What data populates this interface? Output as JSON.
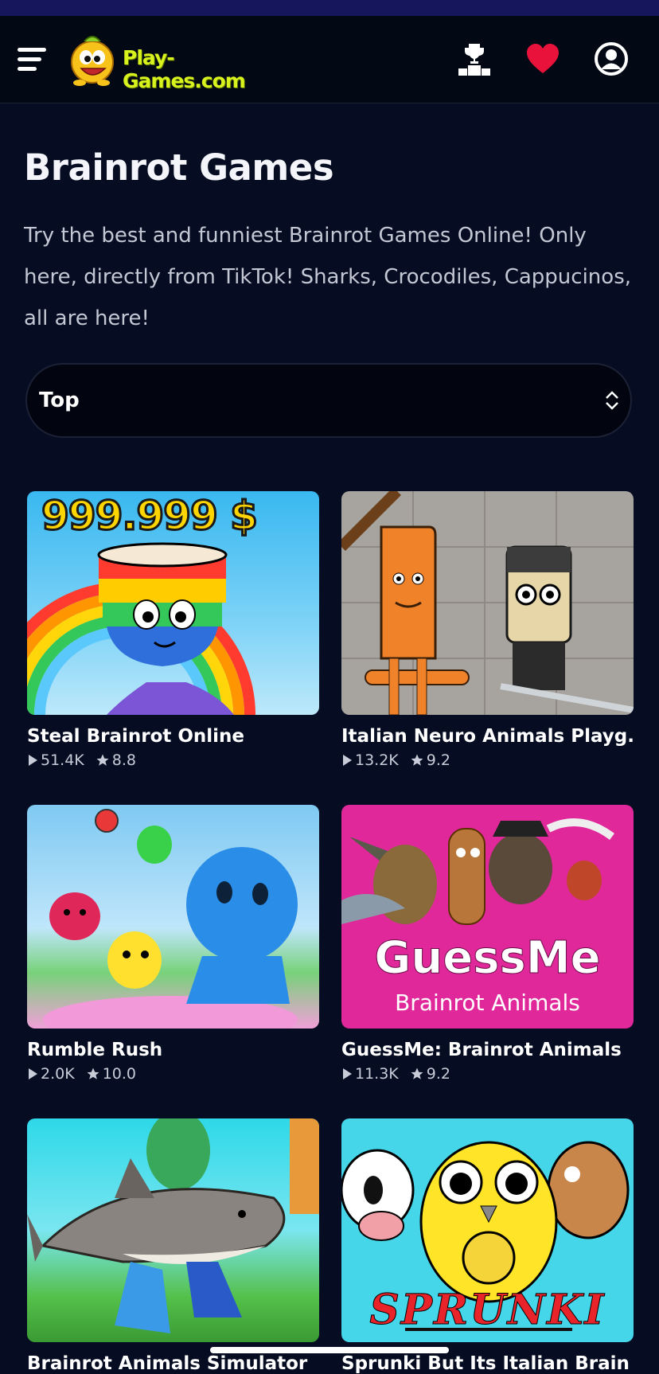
{
  "header": {
    "logo_text": "Play-Games.com",
    "icons": [
      "menu-icon",
      "trophy-icon",
      "heart-icon",
      "user-icon"
    ],
    "heart_color": "#e8123a"
  },
  "page": {
    "title": "Brainrot Games",
    "description": "Try the best and funniest Brainrot Games Online! Only here, directly from TikTok! Sharks, Crocodiles, Cappucinos, all are here!"
  },
  "sort": {
    "selected": "Top"
  },
  "games": [
    {
      "title": "Steal Brainrot Online",
      "plays": "51.4K",
      "rating": "8.8",
      "thumb_text": "999.999 $"
    },
    {
      "title": "Italian Neuro Animals Playg...",
      "plays": "13.2K",
      "rating": "9.2"
    },
    {
      "title": "Rumble Rush",
      "plays": "2.0K",
      "rating": "10.0"
    },
    {
      "title": "GuessMe: Brainrot Animals",
      "plays": "11.3K",
      "rating": "9.2",
      "thumb_text": "GuessMe",
      "thumb_subtext": "Brainrot Animals"
    },
    {
      "title": "Brainrot Animals Simulator",
      "plays": "",
      "rating": ""
    },
    {
      "title": "Sprunki But Its Italian Brain",
      "plays": "",
      "rating": "",
      "thumb_text": "SPRUNKI"
    }
  ],
  "colors": {
    "background": "#060d22",
    "header": "#030815",
    "accent_logo": "#d8f21e"
  }
}
